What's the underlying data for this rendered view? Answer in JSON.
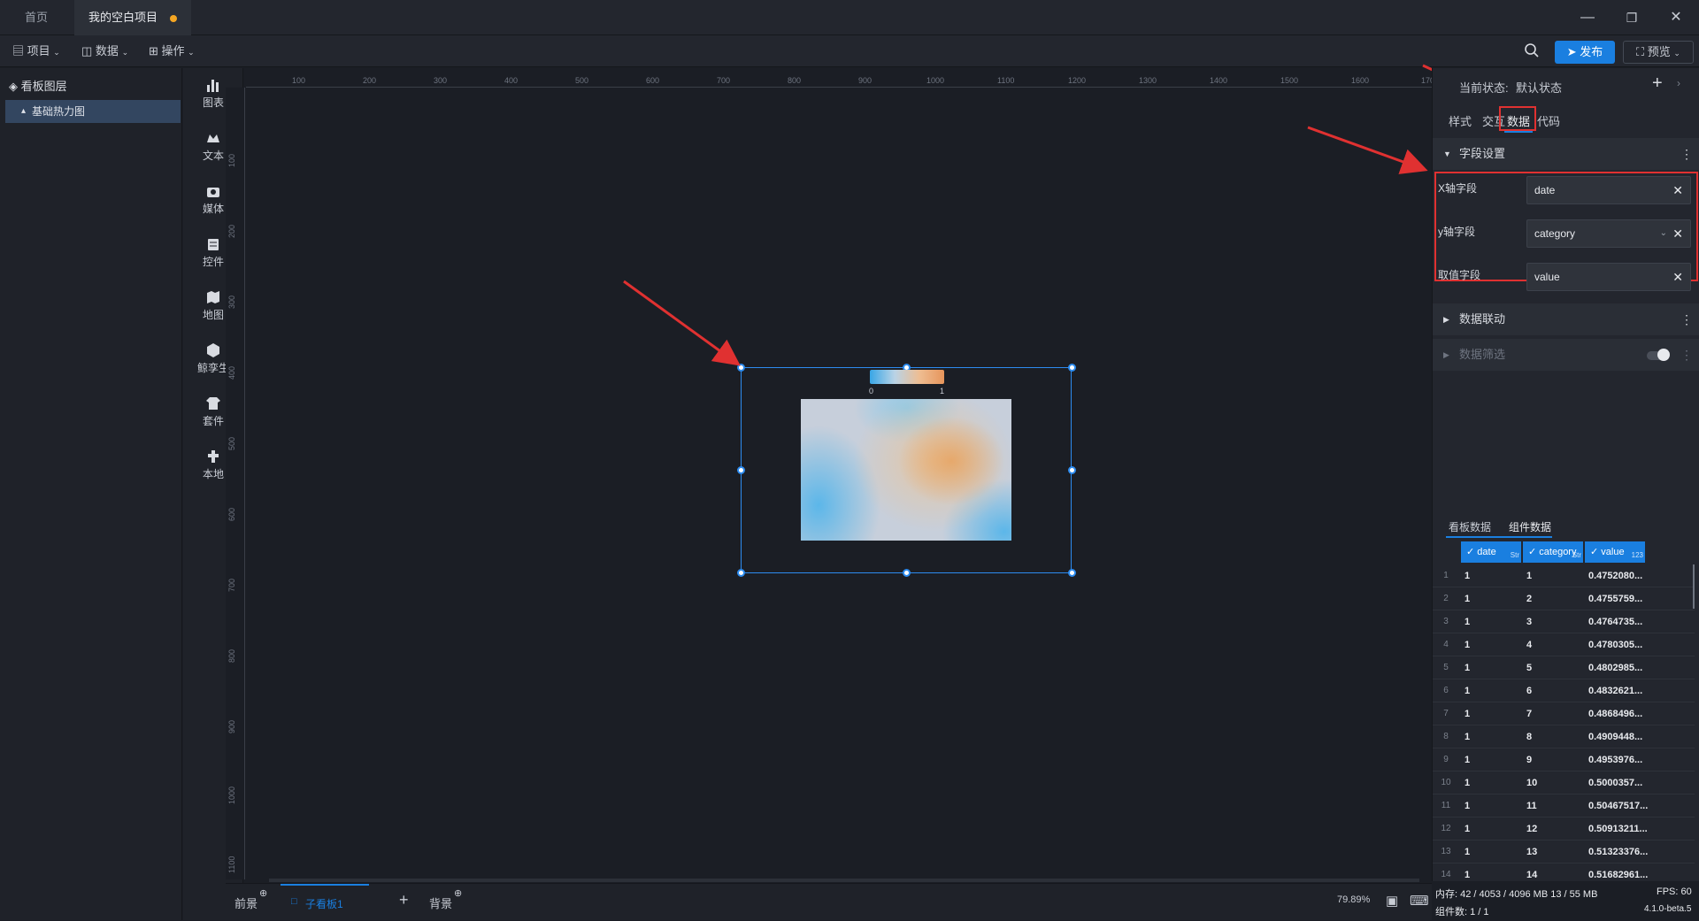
{
  "tabs": [
    {
      "label": "首页"
    },
    {
      "label": "我的空白项目"
    }
  ],
  "toolbar": {
    "project": "项目",
    "data": "数据",
    "operation": "操作",
    "publish": "发布",
    "preview": "预览"
  },
  "layers": {
    "title": "看板图层",
    "items": [
      {
        "label": "基础热力图"
      }
    ]
  },
  "components": [
    {
      "label": "图表",
      "icon": "chart-icon"
    },
    {
      "label": "文本",
      "icon": "text-icon"
    },
    {
      "label": "媒体",
      "icon": "media-icon"
    },
    {
      "label": "控件",
      "icon": "control-icon"
    },
    {
      "label": "地图",
      "icon": "map-icon"
    },
    {
      "label": "鲸孪生",
      "icon": "twin-icon"
    },
    {
      "label": "套件",
      "icon": "suite-icon"
    },
    {
      "label": "本地",
      "icon": "local-icon"
    }
  ],
  "ruler": {
    "top": [
      "100",
      "200",
      "300",
      "400",
      "500",
      "600",
      "700",
      "800",
      "900",
      "1000",
      "1100",
      "1200",
      "1300",
      "1400",
      "1500",
      "1600",
      "170"
    ],
    "left": [
      "100",
      "200",
      "300",
      "400",
      "500",
      "600",
      "700",
      "800",
      "900",
      "1000",
      "1100"
    ]
  },
  "heatmap": {
    "legend_min": "0",
    "legend_max": "1"
  },
  "bottom": {
    "foreground": "前景",
    "subboard": "子看板1",
    "background": "背景",
    "zoom": "79.89%"
  },
  "right_panel": {
    "state_label": "当前状态:",
    "state_value": "默认状态",
    "tabs": [
      "样式",
      "交互",
      "数据",
      "代码"
    ],
    "field_section": "字段设置",
    "fields": [
      {
        "label": "X轴字段",
        "value": "date"
      },
      {
        "label": "y轴字段",
        "value": "category"
      },
      {
        "label": "取值字段",
        "value": "value"
      }
    ],
    "data_link": "数据联动",
    "data_filter": "数据筛选",
    "data_tabs": [
      "看板数据",
      "组件数据"
    ]
  },
  "table": {
    "headers": [
      {
        "name": "date",
        "type": "Str"
      },
      {
        "name": "category",
        "type": "Str"
      },
      {
        "name": "value",
        "type": "123"
      }
    ],
    "rows": [
      [
        "1",
        "1",
        "1",
        "0.4752080..."
      ],
      [
        "2",
        "1",
        "2",
        "0.4755759..."
      ],
      [
        "3",
        "1",
        "3",
        "0.4764735..."
      ],
      [
        "4",
        "1",
        "4",
        "0.4780305..."
      ],
      [
        "5",
        "1",
        "5",
        "0.4802985..."
      ],
      [
        "6",
        "1",
        "6",
        "0.4832621..."
      ],
      [
        "7",
        "1",
        "7",
        "0.4868496..."
      ],
      [
        "8",
        "1",
        "8",
        "0.4909448..."
      ],
      [
        "9",
        "1",
        "9",
        "0.4953976..."
      ],
      [
        "10",
        "1",
        "10",
        "0.5000357..."
      ],
      [
        "11",
        "1",
        "11",
        "0.50467517..."
      ],
      [
        "12",
        "1",
        "12",
        "0.50913211..."
      ],
      [
        "13",
        "1",
        "13",
        "0.51323376..."
      ],
      [
        "14",
        "1",
        "14",
        "0.51682961..."
      ]
    ]
  },
  "status": {
    "memory": "内存: 42 / 4053 / 4096 MB 13 / 55 MB",
    "fps": "FPS: 60",
    "components": "组件数: 1 / 1",
    "version": "4.1.0-beta.5"
  },
  "colors": {
    "accent": "#1a7fe0",
    "annotation": "#e03131",
    "modified_dot": "#f5a623"
  }
}
